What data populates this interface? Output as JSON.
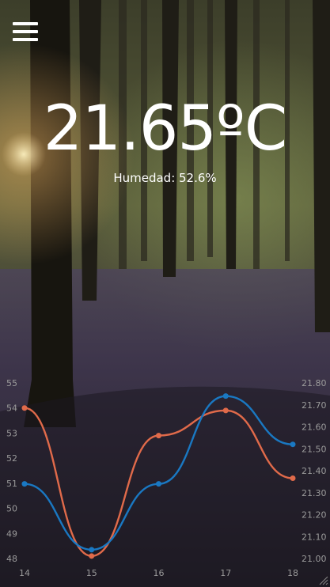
{
  "header": {
    "menu_icon": "hamburger-menu-icon"
  },
  "reading": {
    "temperature": "21.65ºC",
    "humidity": "Humedad: 52.6%"
  },
  "colors": {
    "humidity_series": "#e06a4a",
    "temperature_series": "#1a78c2"
  },
  "chart_data": {
    "type": "line",
    "x": [
      14,
      15,
      16,
      17,
      18
    ],
    "series": [
      {
        "axis": "left",
        "color": "#e06a4a",
        "values": [
          54,
          48.1,
          52.9,
          53.9,
          51.2
        ]
      },
      {
        "axis": "right",
        "color": "#1a78c2",
        "values": [
          21.34,
          21.04,
          21.34,
          21.74,
          21.52
        ]
      }
    ],
    "y_left": {
      "range": [
        48,
        55
      ],
      "ticks": [
        "48",
        "49",
        "50",
        "51",
        "52",
        "53",
        "54",
        "55"
      ]
    },
    "y_right": {
      "range": [
        21.0,
        21.8
      ],
      "ticks": [
        "21.00",
        "21.10",
        "21.20",
        "21.30",
        "21.40",
        "21.50",
        "21.60",
        "21.70",
        "21.80"
      ]
    },
    "x_ticks": [
      "14",
      "15",
      "16",
      "17",
      "18"
    ],
    "grid": false
  }
}
